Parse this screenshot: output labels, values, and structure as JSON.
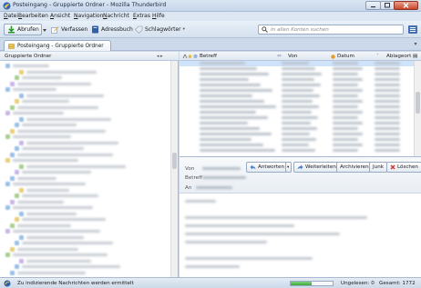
{
  "window": {
    "title": "Posteingang - Gruppierte Ordner - Mozilla Thunderbird"
  },
  "menu": [
    {
      "key": "D",
      "rest": "atei"
    },
    {
      "key": "B",
      "rest": "earbeiten"
    },
    {
      "key": "A",
      "rest": "nsicht"
    },
    {
      "key": "N",
      "rest": "avigation"
    },
    {
      "key": "N",
      "rest": "achricht"
    },
    {
      "key": "E",
      "rest": "xtras"
    },
    {
      "key": "H",
      "rest": "ilfe"
    }
  ],
  "toolbar": {
    "get_mail": "Abrufen",
    "compose": "Verfassen",
    "address_book": "Adressbuch",
    "tags": "Schlagwörter",
    "search_placeholder": "In allen Konten suchen"
  },
  "tab": {
    "label": "Posteingang - Gruppierte Ordner"
  },
  "folder_pane": {
    "header": "Gruppierte Ordner",
    "nav": "◂ ▸"
  },
  "thread_columns": {
    "subject": "Betreff",
    "from": "Von",
    "date": "Datum",
    "location": "Ablageort"
  },
  "message_header": {
    "from_label": "Von",
    "subject_label": "Betreff",
    "to_label": "An",
    "reply": "Antworten",
    "forward": "Weiterleiten",
    "archive": "Archivieren",
    "junk": "Junk",
    "delete": "Löschen"
  },
  "status": {
    "text": "Zu indizierende Nachrichten werden ermittelt",
    "unread": "Ungelesen: 0",
    "total": "Gesamt: 1772",
    "progress": 0.5
  },
  "colors": {
    "selection": "#cfe3fb",
    "accent": "#3f6fb0",
    "delete_red": "#d0302a"
  }
}
